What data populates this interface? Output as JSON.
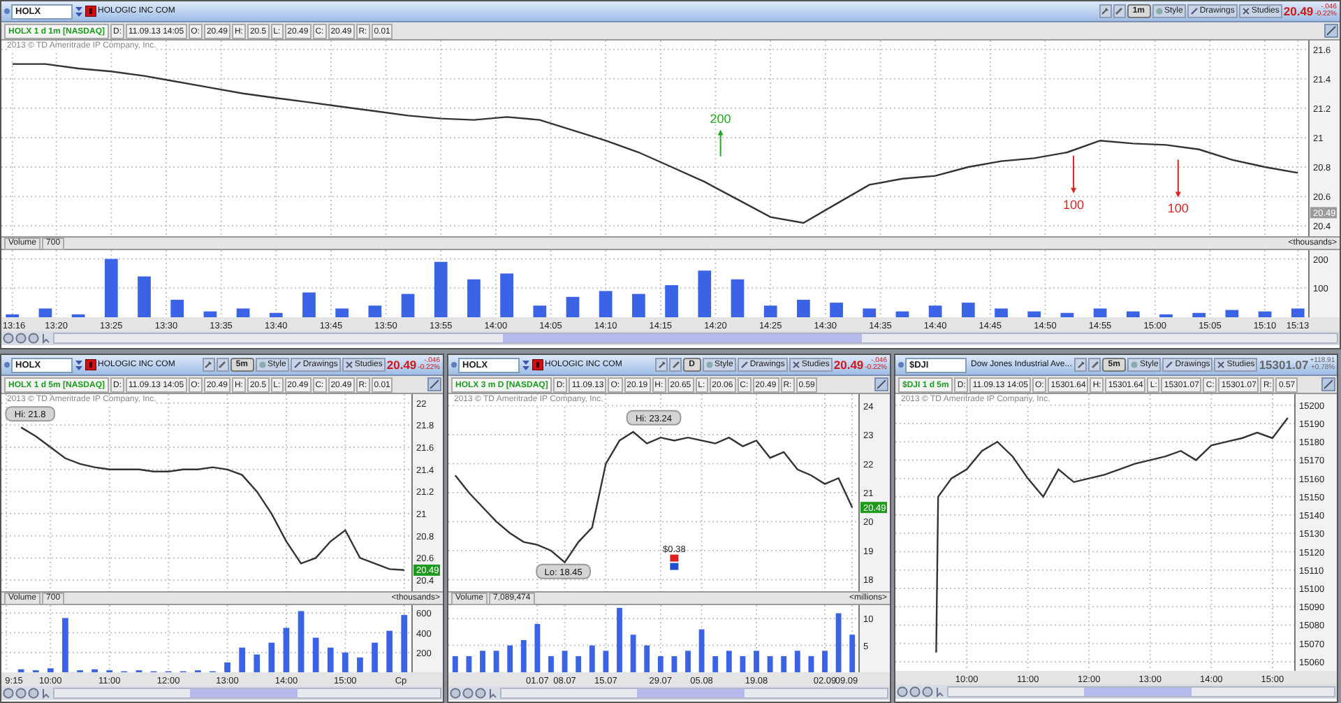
{
  "panels": [
    {
      "symbol": "HOLX",
      "company": "HOLOGIC INC COM",
      "interval": "1m",
      "toolbar": [
        "Style",
        "Drawings",
        "Studies"
      ],
      "price": "20.49",
      "color": "#d01818",
      "change": "-.046",
      "change_pct": "-0.22%",
      "info_label": "HOLX 1 d 1m [NASDAQ]",
      "fields": [
        {
          "name": "D:",
          "value": "11.09.13 14:05"
        },
        {
          "name": "O:",
          "value": "20.49"
        },
        {
          "name": "H:",
          "value": "20.5"
        },
        {
          "name": "L:",
          "value": "20.49"
        },
        {
          "name": "C:",
          "value": "20.49"
        },
        {
          "name": "R:",
          "value": "0.01"
        }
      ],
      "copyright": "2013 © TD Ameritrade IP Company, Inc.",
      "last_tag": "20.49",
      "callouts": [
        {
          "kind": "buy",
          "text": "200"
        },
        {
          "kind": "sell",
          "text": "100"
        },
        {
          "kind": "sell",
          "text": "100"
        }
      ],
      "chart_data": {
        "type": "line",
        "categories": [
          null,
          null,
          null,
          null,
          null,
          null,
          null,
          null,
          null,
          null,
          null,
          null,
          null,
          null,
          null,
          null,
          null,
          null,
          null,
          null,
          null,
          null,
          null,
          null,
          null,
          null,
          null,
          null,
          null,
          null,
          null,
          null,
          null,
          null,
          null,
          null,
          null,
          null,
          null,
          null
        ],
        "series": [
          {
            "color": "#333333",
            "values": [
              21.5,
              21.5,
              21.47,
              21.45,
              21.42,
              21.38,
              21.34,
              21.3,
              21.27,
              21.24,
              21.21,
              21.18,
              21.15,
              21.13,
              21.12,
              21.14,
              21.12,
              21.05,
              20.98,
              20.9,
              20.8,
              20.7,
              20.58,
              20.46,
              20.42,
              20.55,
              20.68,
              20.72,
              20.74,
              20.8,
              20.84,
              20.86,
              20.9,
              20.98,
              20.96,
              20.95,
              20.92,
              20.85,
              20.8,
              20.76
            ]
          }
        ],
        "ylim": [
          20.33,
          21.66
        ],
        "yticks": [
          20.4,
          20.6,
          20.8,
          21,
          21.2,
          21.4,
          21.6
        ],
        "grid": true
      },
      "volume": {
        "value": "700",
        "unit": "<thousands>",
        "chart_data": {
          "type": "bar",
          "x": [
            796,
            799,
            802,
            805,
            808,
            811,
            814,
            817,
            820,
            823,
            826,
            829,
            832,
            835,
            838,
            841,
            844,
            847,
            850,
            853,
            856,
            859,
            862,
            865,
            868,
            871,
            874,
            877,
            880,
            883,
            886,
            889,
            892,
            895,
            898,
            901,
            904,
            907,
            910,
            913
          ],
          "series": [
            {
              "name": "Volume",
              "color": "#3b63e6",
              "values": [
                10,
                30,
                10,
                200,
                140,
                60,
                20,
                30,
                15,
                85,
                30,
                40,
                80,
                190,
                130,
                150,
                40,
                70,
                90,
                80,
                110,
                160,
                130,
                40,
                60,
                50,
                30,
                20,
                40,
                50,
                30,
                20,
                15,
                30,
                20,
                10,
                15,
                25,
                20,
                30
              ]
            }
          ],
          "xlim": [
            795,
            914
          ],
          "ylim": [
            0,
            230
          ],
          "yticks": [
            100,
            200
          ],
          "grid": true,
          "xticks": [
            {
              "value": 796,
              "label": "13:16"
            },
            {
              "value": 800,
              "label": "13:20"
            },
            {
              "value": 805,
              "label": "13:25"
            },
            {
              "value": 810,
              "label": "13:30"
            },
            {
              "value": 815,
              "label": "13:35"
            },
            {
              "value": 820,
              "label": "13:40"
            },
            {
              "value": 825,
              "label": "13:45"
            },
            {
              "value": 830,
              "label": "13:50"
            },
            {
              "value": 835,
              "label": "13:55"
            },
            {
              "value": 840,
              "label": "14:00"
            },
            {
              "value": 845,
              "label": "14:05"
            },
            {
              "value": 850,
              "label": "14:10"
            },
            {
              "value": 855,
              "label": "14:15"
            },
            {
              "value": 860,
              "label": "14:20"
            },
            {
              "value": 865,
              "label": "14:25"
            },
            {
              "value": 870,
              "label": "14:30"
            },
            {
              "value": 875,
              "label": "14:35"
            },
            {
              "value": 880,
              "label": "14:40"
            },
            {
              "value": 885,
              "label": "14:45"
            },
            {
              "value": 890,
              "label": "14:50"
            },
            {
              "value": 895,
              "label": "14:55"
            },
            {
              "value": 900,
              "label": "15:00"
            },
            {
              "value": 905,
              "label": "15:05"
            },
            {
              "value": 910,
              "label": "15:10"
            },
            {
              "value": 913,
              "label": "15:13"
            }
          ]
        }
      }
    },
    {
      "symbol": "HOLX",
      "company": "HOLOGIC INC COM",
      "interval": "5m",
      "toolbar": [
        "Style",
        "Drawings",
        "Studies"
      ],
      "price": "20.49",
      "color": "#d01818",
      "change": "-.046",
      "change_pct": "-0.22%",
      "info_label": "HOLX 1 d 5m [NASDAQ]",
      "fields": [
        {
          "name": "D:",
          "value": "11.09.13 14:05"
        },
        {
          "name": "O:",
          "value": "20.49"
        },
        {
          "name": "H:",
          "value": "20.5"
        },
        {
          "name": "L:",
          "value": "20.49"
        },
        {
          "name": "C:",
          "value": "20.49"
        },
        {
          "name": "R:",
          "value": "0.01"
        }
      ],
      "copyright": "2013 © TD Ameritrade IP Company, Inc.",
      "last_tag": "20.49",
      "callouts": [
        {
          "kind": "high",
          "text": "Hi: 21.8"
        }
      ],
      "chart_data": {
        "type": "line",
        "categories": [
          null,
          null,
          null,
          null,
          null,
          null,
          null,
          null,
          null,
          null,
          null,
          null,
          null,
          null,
          null,
          null,
          null,
          null,
          null,
          null,
          null,
          null,
          null,
          null,
          null,
          null,
          null
        ],
        "series": [
          {
            "color": "#333333",
            "values": [
              21.78,
              21.7,
              21.6,
              21.5,
              21.45,
              21.42,
              21.4,
              21.4,
              21.4,
              21.38,
              21.38,
              21.4,
              21.4,
              21.42,
              21.4,
              21.35,
              21.2,
              21.0,
              20.75,
              20.55,
              20.6,
              20.75,
              20.85,
              20.6,
              20.55,
              20.5,
              20.49
            ]
          }
        ],
        "ylim": [
          20.3,
          22.08
        ],
        "yticks": [
          20.4,
          20.6,
          20.8,
          21,
          21.2,
          21.4,
          21.6,
          21.8,
          22
        ],
        "grid": true
      },
      "volume": {
        "value": "700",
        "unit": "<thousands>",
        "chart_data": {
          "type": "bar",
          "x": [
            570,
            585,
            600,
            615,
            630,
            645,
            660,
            675,
            690,
            705,
            720,
            735,
            750,
            765,
            780,
            795,
            810,
            825,
            840,
            855,
            870,
            885,
            900,
            915,
            930,
            945,
            960
          ],
          "series": [
            {
              "name": "Volume",
              "color": "#3b63e6",
              "values": [
                30,
                20,
                40,
                550,
                20,
                30,
                20,
                10,
                20,
                10,
                10,
                10,
                20,
                10,
                100,
                250,
                180,
                300,
                450,
                620,
                350,
                250,
                200,
                150,
                300,
                420,
                580
              ]
            }
          ],
          "xlim": [
            550,
            968
          ],
          "ylim": [
            0,
            680
          ],
          "yticks": [
            200,
            400,
            600
          ],
          "grid": true,
          "xticks": [
            {
              "value": 555,
              "label": "9:15"
            },
            {
              "value": 600,
              "label": "10:00"
            },
            {
              "value": 660,
              "label": "11:00"
            },
            {
              "value": 720,
              "label": "12:00"
            },
            {
              "value": 780,
              "label": "13:00"
            },
            {
              "value": 840,
              "label": "14:00"
            },
            {
              "value": 900,
              "label": "15:00"
            },
            {
              "value": 960,
              "label": "Cp"
            }
          ]
        }
      }
    },
    {
      "symbol": "HOLX",
      "company": "HOLOGIC INC COM",
      "interval": "D",
      "toolbar": [
        "Style",
        "Drawings",
        "Studies"
      ],
      "price": "20.49",
      "color": "#d01818",
      "change": "-.046",
      "change_pct": "-0.22%",
      "info_label": "HOLX 3 m D [NASDAQ]",
      "fields": [
        {
          "name": "D:",
          "value": "11.09.13"
        },
        {
          "name": "O:",
          "value": "20.19"
        },
        {
          "name": "H:",
          "value": "20.65"
        },
        {
          "name": "L:",
          "value": "20.06"
        },
        {
          "name": "C:",
          "value": "20.49"
        },
        {
          "name": "R:",
          "value": "0.59"
        }
      ],
      "copyright": "2013 © TD Ameritrade IP Company, Inc.",
      "last_tag": "20.49",
      "callouts": [
        {
          "kind": "high",
          "text": "Hi: 23.24"
        },
        {
          "kind": "low",
          "text": "Lo: 18.45"
        },
        {
          "kind": "dividend",
          "text": "$0.38"
        }
      ],
      "chart_data": {
        "type": "line",
        "categories": [
          null,
          null,
          null,
          null,
          null,
          null,
          null,
          null,
          null,
          null,
          null,
          null,
          null,
          null,
          null,
          null,
          null,
          null,
          null,
          null,
          null,
          null,
          null,
          null,
          null,
          null,
          null,
          null,
          null,
          null
        ],
        "series": [
          {
            "color": "#333333",
            "values": [
              21.6,
              21.0,
              20.5,
              20.0,
              19.6,
              19.3,
              19.2,
              19.0,
              18.6,
              19.3,
              19.8,
              22.0,
              22.8,
              23.1,
              22.7,
              22.9,
              22.8,
              22.9,
              22.8,
              22.7,
              22.9,
              22.6,
              22.8,
              22.2,
              22.4,
              21.8,
              21.6,
              21.3,
              21.5,
              20.49
            ]
          }
        ],
        "ylim": [
          17.6,
          24.4
        ],
        "yticks": [
          18,
          19,
          20,
          21,
          22,
          23,
          24
        ],
        "grid": true
      },
      "volume": {
        "value": "7,089,474",
        "unit": "<millions>",
        "chart_data": {
          "type": "bar",
          "categories": [
            null,
            null,
            null,
            null,
            null,
            null,
            "01.07",
            null,
            "08.07",
            null,
            null,
            "15.07",
            null,
            null,
            null,
            "29.07",
            null,
            null,
            "05.08",
            null,
            null,
            null,
            "19.08",
            null,
            null,
            null,
            null,
            "02.09",
            null,
            "09.09"
          ],
          "series": [
            {
              "name": "Volume",
              "color": "#3b63e6",
              "values": [
                3,
                3,
                4,
                4,
                5,
                6,
                9,
                3,
                4,
                3,
                5,
                4,
                12,
                7,
                5,
                3,
                3,
                4,
                8,
                3,
                4,
                3,
                4,
                3,
                3,
                4,
                3,
                4,
                11,
                7
              ]
            }
          ],
          "ylim": [
            0,
            12.5
          ],
          "yticks": [
            5,
            10
          ],
          "grid": true
        }
      }
    },
    {
      "symbol": "$DJI",
      "company": "Dow Jones Industrial Ave...",
      "interval": "5m",
      "toolbar": [
        "Style",
        "Drawings",
        "Studies"
      ],
      "price": "15301.07",
      "color": "#666666",
      "change": "+118.91",
      "change_pct": "+0.78%",
      "info_label": "$DJI 1 d 5m",
      "fields": [
        {
          "name": "D:",
          "value": "11.09.13 14:05"
        },
        {
          "name": "O:",
          "value": "15301.64"
        },
        {
          "name": "H:",
          "value": "15301.64"
        },
        {
          "name": "L:",
          "value": "15301.07"
        },
        {
          "name": "C:",
          "value": "15301.07"
        },
        {
          "name": "R:",
          "value": "0.57"
        }
      ],
      "copyright": "2013 © TD Ameritrade IP Company, Inc.",
      "chart_data": {
        "type": "line",
        "x": [
          570,
          572,
          585,
          600,
          615,
          630,
          645,
          660,
          675,
          690,
          705,
          720,
          735,
          750,
          765,
          780,
          795,
          810,
          825,
          840,
          855,
          870,
          885,
          900,
          915
        ],
        "series": [
          {
            "color": "#333333",
            "values": [
              15065,
              15150,
              15160,
              15165,
              15175,
              15180,
              15172,
              15160,
              15150,
              15165,
              15158,
              15160,
              15162,
              15165,
              15168,
              15170,
              15172,
              15175,
              15170,
              15178,
              15180,
              15182,
              15185,
              15182,
              15193
            ]
          }
        ],
        "xlim": [
          530,
          922
        ],
        "ylim": [
          15055,
          15206
        ],
        "grid": true,
        "yticks": [
          15060,
          15070,
          15080,
          15090,
          15100,
          15110,
          15120,
          15130,
          15140,
          15150,
          15160,
          15170,
          15180,
          15190,
          15200
        ],
        "xticks": [
          {
            "value": 600,
            "label": "10:00"
          },
          {
            "value": 660,
            "label": "11:00"
          },
          {
            "value": 720,
            "label": "12:00"
          },
          {
            "value": 780,
            "label": "13:00"
          },
          {
            "value": 840,
            "label": "14:00"
          },
          {
            "value": 900,
            "label": "15:00"
          }
        ]
      }
    }
  ]
}
